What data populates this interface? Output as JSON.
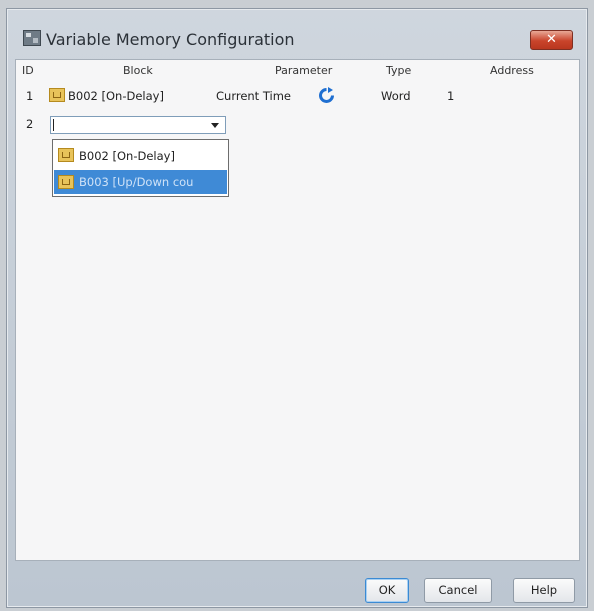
{
  "window": {
    "title": "Variable Memory Configuration",
    "close_label": "✕"
  },
  "table": {
    "headers": {
      "id": "ID",
      "block": "Block",
      "parameter": "Parameter",
      "type": "Type",
      "address": "Address"
    },
    "rows": [
      {
        "id": "1",
        "block": "B002 [On-Delay]",
        "parameter": "Current Time",
        "type": "Word",
        "address": "1"
      },
      {
        "id": "2",
        "block": "",
        "parameter": "",
        "type": "",
        "address": ""
      }
    ]
  },
  "dropdown": {
    "options": [
      "B002 [On-Delay]",
      "B003 [Up/Down cou"
    ],
    "selected_index": 1
  },
  "buttons": {
    "ok": "OK",
    "cancel": "Cancel",
    "help": "Help"
  },
  "colors": {
    "selection": "#3f8ad6",
    "close": "#c9442b",
    "block_icon": "#e8c35a",
    "refresh_icon": "#1f6fd1"
  },
  "icons": {
    "block": "timer-block-icon",
    "parameter_action": "refresh-icon",
    "app": "app-icon"
  }
}
